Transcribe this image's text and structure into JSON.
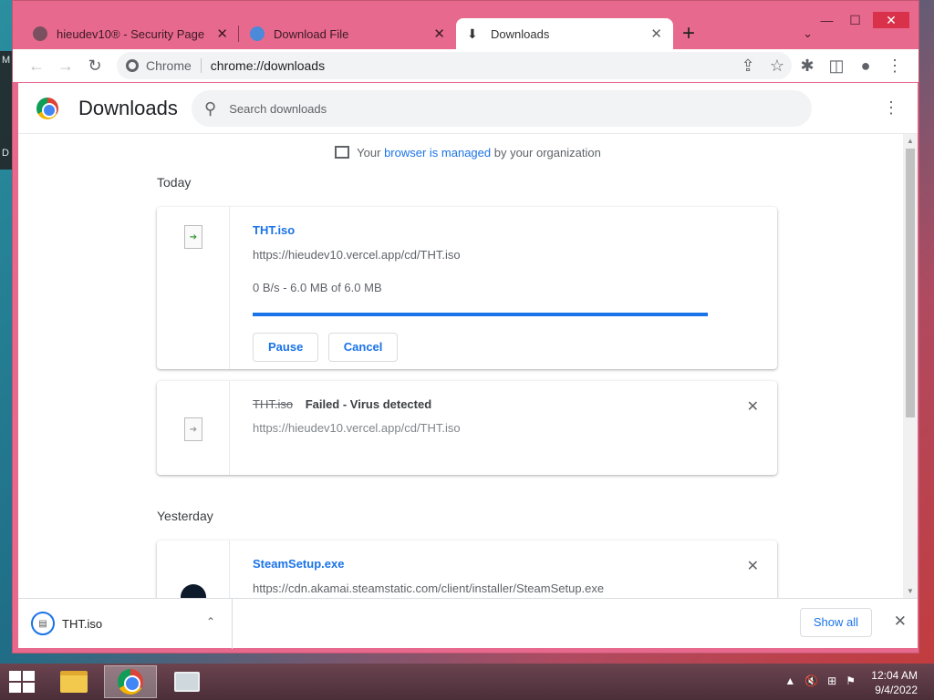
{
  "desktop": {
    "left_labels": [
      "M",
      "D"
    ]
  },
  "window": {
    "minimize": "—",
    "maximize": "☐",
    "close": "✕"
  },
  "tabs": [
    {
      "title": "hieudev10® - Security Page",
      "close": "✕"
    },
    {
      "title": "Download File",
      "close": "✕"
    },
    {
      "title": "Downloads",
      "close": "✕"
    }
  ],
  "new_tab": "+",
  "tab_menu": "⌄",
  "toolbar": {
    "back": "←",
    "forward": "→",
    "reload": "↻",
    "site_name": "Chrome",
    "url": "chrome://downloads",
    "share": "⇪",
    "bookmark": "☆",
    "extensions": "✱",
    "sidepanel": "◫",
    "profile": "●",
    "menu": "⋮"
  },
  "downloads_page": {
    "title": "Downloads",
    "search_placeholder": "Search downloads",
    "menu": "⋮",
    "managed": {
      "prefix": "Your ",
      "link": "browser is managed",
      "suffix": " by your organization"
    },
    "sections": [
      {
        "heading": "Today",
        "items": [
          {
            "filename": "THT.iso",
            "url": "https://hieudev10.vercel.app/cd/THT.iso",
            "status": "0 B/s - 6.0 MB of 6.0 MB",
            "progress": 1.0,
            "buttons": [
              "Pause",
              "Cancel"
            ]
          },
          {
            "filename": "THT.iso",
            "status": "Failed - Virus detected",
            "url": "https://hieudev10.vercel.app/cd/THT.iso",
            "close": "✕"
          }
        ]
      },
      {
        "heading": "Yesterday",
        "items": [
          {
            "filename": "SteamSetup.exe",
            "url": "https://cdn.akamai.steamstatic.com/client/installer/SteamSetup.exe",
            "close": "✕"
          }
        ]
      }
    ]
  },
  "shelf": {
    "filename": "THT.iso",
    "chevron": "⌃",
    "show_all": "Show all",
    "close": "✕"
  },
  "taskbar": {
    "tray": [
      "▲",
      "🔇",
      "⊞",
      "⚑"
    ],
    "time": "12:04 AM",
    "date": "9/4/2022"
  },
  "colors": {
    "accent": "#1a73e8",
    "frame": "#e8698e",
    "taskbar": "#5a3845"
  }
}
